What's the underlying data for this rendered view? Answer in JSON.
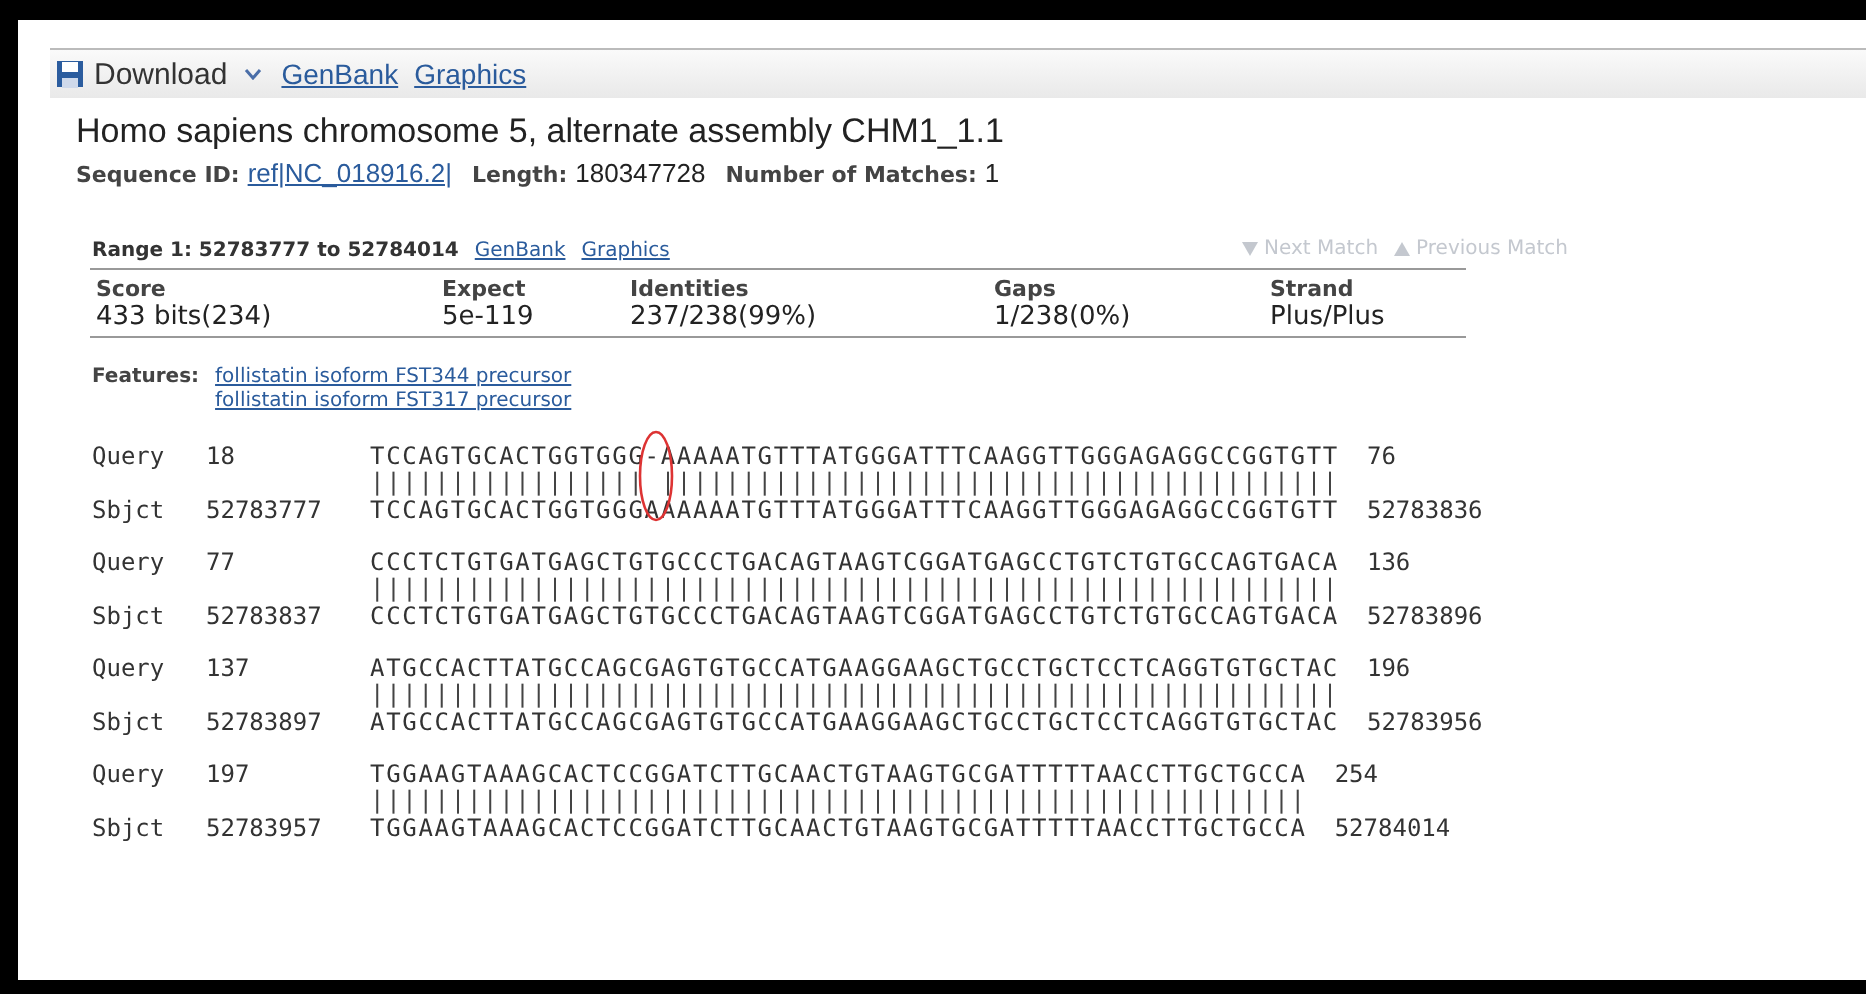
{
  "toolbar": {
    "download": "Download",
    "links": [
      "GenBank",
      "Graphics"
    ]
  },
  "title": "Homo sapiens chromosome 5, alternate assembly CHM1_1.1",
  "meta": [
    {
      "label": "Sequence ID:",
      "value": "ref|NC_018916.2|",
      "kind": "link"
    },
    {
      "label": "Length:",
      "value": "180347728",
      "kind": "text"
    },
    {
      "label": "Number of Matches:",
      "value": "1",
      "kind": "text"
    }
  ],
  "range": {
    "label": "Range 1: 52783777 to 52784014",
    "links": [
      "GenBank",
      "Graphics"
    ],
    "nav": [
      {
        "label": "Next Match",
        "kind": "down",
        "disabled": true
      },
      {
        "label": "Previous Match",
        "kind": "up",
        "disabled": true
      }
    ]
  },
  "stats": {
    "columns": [
      "Score",
      "Expect",
      "Identities",
      "Gaps",
      "Strand"
    ],
    "values": [
      "433 bits(234)",
      "5e-119",
      "237/238(99%)",
      "1/238(0%)",
      "Plus/Plus"
    ]
  },
  "features": {
    "label": "Features:",
    "links": [
      "follistatin isoform FST344 precursor",
      "follistatin isoform FST317 precursor"
    ]
  },
  "alignment": [
    {
      "query_label": "Query",
      "query_start": "18",
      "query": "TCCAGTGCACTGGTGGG-AAAAATGTTTATGGGATTTCAAGGTTGGGAGAGGCCGGTGTT",
      "query_end": "76",
      "midline": "||||||||||||||||| ||||||||||||||||||||||||||||||||||||||||||",
      "sbjct_label": "Sbjct",
      "sbjct_start": "52783777",
      "sbjct": "TCCAGTGCACTGGTGGGAAAAAATGTTTATGGGATTTCAAGGTTGGGAGAGGCCGGTGTT",
      "sbjct_end": "52783836",
      "circled": true
    },
    {
      "query_label": "Query",
      "query_start": "77",
      "query": "CCCTCTGTGATGAGCTGTGCCCTGACAGTAAGTCGGATGAGCCTGTCTGTGCCAGTGACA",
      "query_end": "136",
      "midline": "||||||||||||||||||||||||||||||||||||||||||||||||||||||||||||",
      "sbjct_label": "Sbjct",
      "sbjct_start": "52783837",
      "sbjct": "CCCTCTGTGATGAGCTGTGCCCTGACAGTAAGTCGGATGAGCCTGTCTGTGCCAGTGACA",
      "sbjct_end": "52783896",
      "circled": false
    },
    {
      "query_label": "Query",
      "query_start": "137",
      "query": "ATGCCACTTATGCCAGCGAGTGTGCCATGAAGGAAGCTGCCTGCTCCTCAGGTGTGCTAC",
      "query_end": "196",
      "midline": "||||||||||||||||||||||||||||||||||||||||||||||||||||||||||||",
      "sbjct_label": "Sbjct",
      "sbjct_start": "52783897",
      "sbjct": "ATGCCACTTATGCCAGCGAGTGTGCCATGAAGGAAGCTGCCTGCTCCTCAGGTGTGCTAC",
      "sbjct_end": "52783956",
      "circled": false
    },
    {
      "query_label": "Query",
      "query_start": "197",
      "query": "TGGAAGTAAAGCACTCCGGATCTTGCAACTGTAAGTGCGATTTTTAACCTTGCTGCCA",
      "query_end": "254",
      "midline": "||||||||||||||||||||||||||||||||||||||||||||||||||||||||||",
      "sbjct_label": "Sbjct",
      "sbjct_start": "52783957",
      "sbjct": "TGGAAGTAAAGCACTCCGGATCTTGCAACTGTAAGTGCGATTTTTAACCTTGCTGCCA",
      "sbjct_end": "52784014",
      "circled": false
    }
  ]
}
